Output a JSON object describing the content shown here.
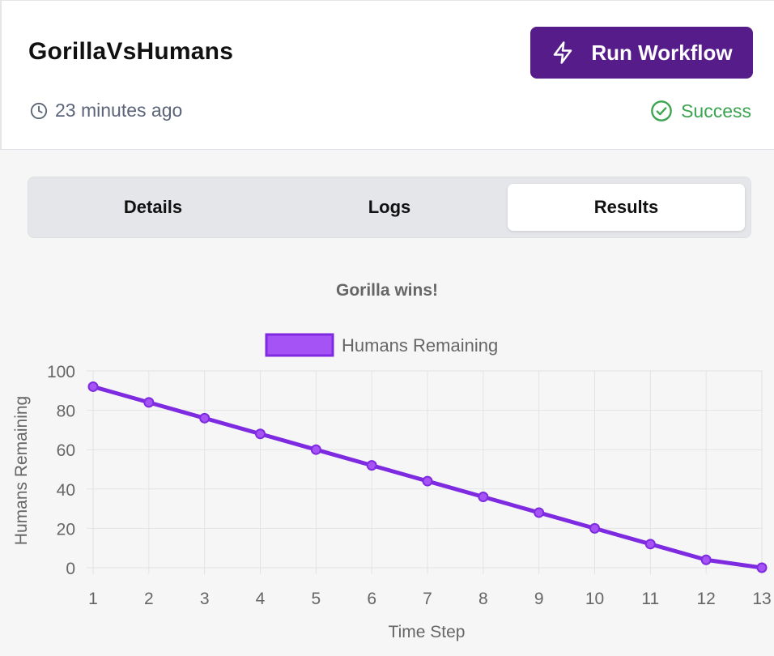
{
  "header": {
    "title": "GorillaVsHumans",
    "run_button_label": "Run Workflow",
    "run_button_icon": "lightning-bolt-icon",
    "timestamp": "23 minutes ago",
    "timestamp_icon": "clock-icon",
    "status": "Success",
    "status_icon": "check-circle-icon",
    "status_color": "#3ba44e",
    "accent_color": "#561d8a"
  },
  "tabs": [
    {
      "label": "Details",
      "active": false
    },
    {
      "label": "Logs",
      "active": false
    },
    {
      "label": "Results",
      "active": true
    }
  ],
  "chart_data": {
    "type": "line",
    "title": "Gorilla wins!",
    "xlabel": "Time Step",
    "ylabel": "Humans Remaining",
    "x": [
      1,
      2,
      3,
      4,
      5,
      6,
      7,
      8,
      9,
      10,
      11,
      12,
      13
    ],
    "series": [
      {
        "name": "Humans Remaining",
        "values": [
          92,
          84,
          76,
          68,
          60,
          52,
          44,
          36,
          28,
          20,
          12,
          4,
          0
        ],
        "color": "#7e2ae0",
        "fill": "#a653f5"
      }
    ],
    "ylim": [
      0,
      100
    ],
    "yticks": [
      0,
      20,
      40,
      60,
      80,
      100
    ],
    "grid": true,
    "legend": "top-center"
  }
}
